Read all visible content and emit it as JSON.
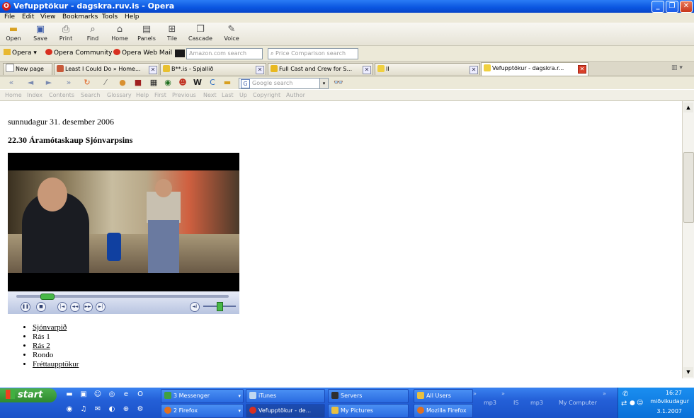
{
  "titlebar": {
    "title": "Vefupptökur - dagskra.ruv.is - Opera"
  },
  "menu": [
    "File",
    "Edit",
    "View",
    "Bookmarks",
    "Tools",
    "Help"
  ],
  "toolbar": [
    {
      "label": "Open",
      "icon": "folder-icon"
    },
    {
      "label": "Save",
      "icon": "save-icon"
    },
    {
      "label": "Print",
      "icon": "print-icon"
    },
    {
      "label": "Find",
      "icon": "find-icon"
    },
    {
      "label": "Home",
      "icon": "home-icon"
    },
    {
      "label": "Panels",
      "icon": "panels-icon"
    },
    {
      "label": "Tile",
      "icon": "tile-icon"
    },
    {
      "label": "Cascade",
      "icon": "cascade-icon"
    },
    {
      "label": "Voice",
      "icon": "voice-icon"
    }
  ],
  "personal_bar": {
    "items": [
      "Opera",
      "Opera Community",
      "Opera Web Mail"
    ],
    "search1": "Amazon.com search",
    "search2": "Price Comparison search"
  },
  "tabs": [
    {
      "label": "New page"
    },
    {
      "label": "Least I Could Do » Home..."
    },
    {
      "label": "B**.is - Spjallið"
    },
    {
      "label": "Full Cast and Crew for S..."
    },
    {
      "label": "II"
    },
    {
      "label": "Vefupptökur - dagskra.r...",
      "active": true
    }
  ],
  "nav": {
    "search_placeholder": "Google search"
  },
  "nav_links": [
    "Home",
    "Index",
    "Contents",
    "Search",
    "Glossary",
    "Help",
    "First",
    "Previous",
    "Next",
    "Last",
    "Up",
    "Copyright",
    "Author"
  ],
  "page": {
    "date": "sunnudagur 31. desember 2006",
    "program": "22.30 Áramótaskaup Sjónvarpsins",
    "channels": [
      {
        "label": "Sjónvarpið",
        "link": true
      },
      {
        "label": "Rás 1",
        "link": false
      },
      {
        "label": "Rás 2",
        "link": true
      },
      {
        "label": "Rondo",
        "link": false
      },
      {
        "label": "Fréttaupptökur",
        "link": true
      }
    ],
    "seek_progress": 0.15,
    "volume": 0.6
  },
  "taskbar": {
    "start": "start",
    "tasks_row1": [
      {
        "label": "3 Messenger",
        "dropdown": true
      },
      {
        "label": "iTunes"
      },
      {
        "label": "Servers"
      },
      {
        "label": "All Users"
      }
    ],
    "tasks_row2": [
      {
        "label": "2 Firefox",
        "dropdown": true
      },
      {
        "label": "Vefupptökur - de...",
        "active": true
      },
      {
        "label": "My Pictures"
      },
      {
        "label": "Mozilla Firefox"
      }
    ],
    "tray_labels": [
      "mp3",
      "IS",
      "mp3",
      "My Computer"
    ],
    "clock": "16:27",
    "day": "miðvikudagur",
    "date": "3.1.2007"
  }
}
